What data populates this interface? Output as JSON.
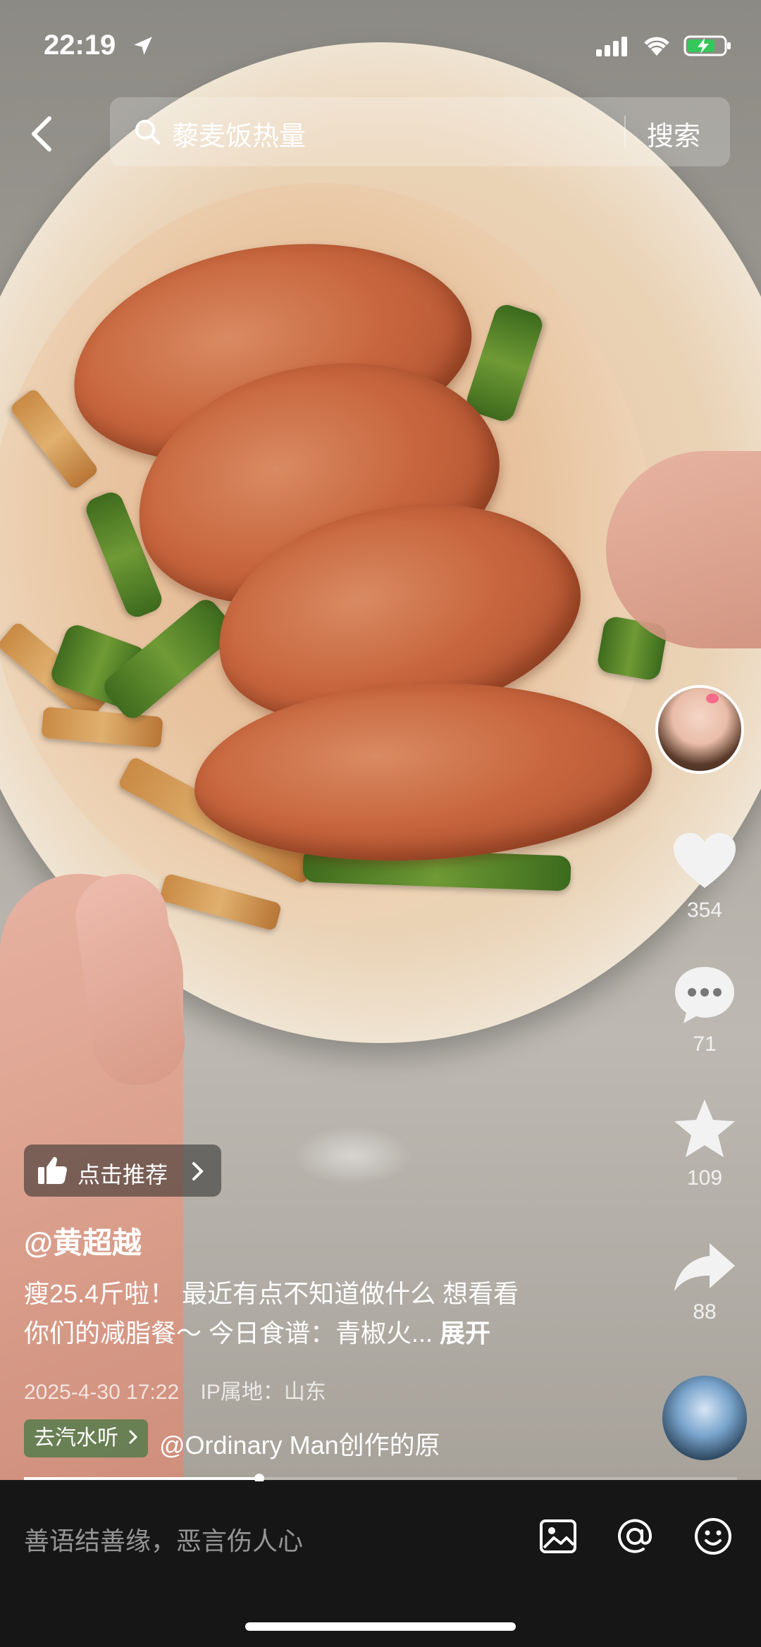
{
  "status_bar": {
    "time": "22:19"
  },
  "search": {
    "query": "藜麦饭热量",
    "button_label": "搜索"
  },
  "actions": {
    "likes": "354",
    "comments": "71",
    "favorites": "109",
    "shares": "88"
  },
  "recommend": {
    "label": "点击推荐"
  },
  "post": {
    "author": "@黄超越",
    "description_line1": "瘦25.4斤啦！ 最近有点不知道做什么 想看看",
    "description_line2": "你们的减脂餐～ 今日食谱：青椒火...",
    "expand_label": "展开",
    "date": "2025-4-30 17:22",
    "ip_location": "IP属地：山东"
  },
  "music": {
    "tag_label": "去汽水听",
    "text": "@Ordinary Man创作的原"
  },
  "progress_fraction": 0.33,
  "comment_bar": {
    "placeholder": "善语结善缘，恶言伤人心"
  },
  "colors": {
    "accent_green": "#4f7a48",
    "bottom_bg": "#161616"
  }
}
